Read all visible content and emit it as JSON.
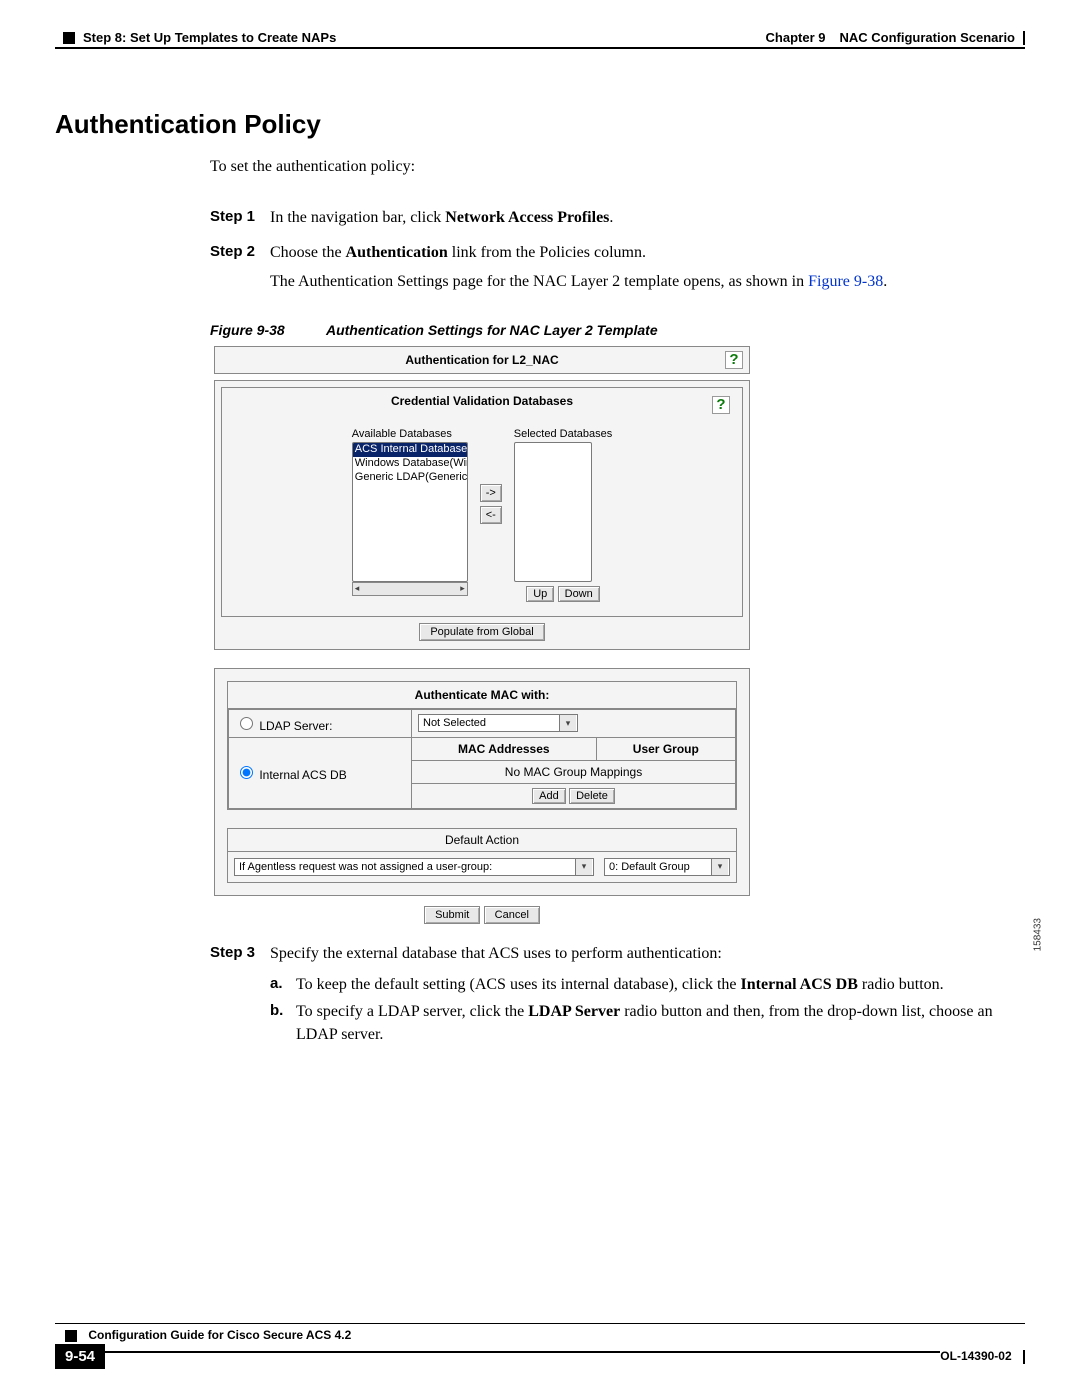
{
  "header": {
    "left": "Step 8: Set Up Templates to Create NAPs",
    "right_chapter": "Chapter 9",
    "right_title": "NAC Configuration Scenario"
  },
  "section_title": "Authentication Policy",
  "intro": "To set the authentication policy:",
  "steps": {
    "s1_label": "Step 1",
    "s1_pre": "In the navigation bar, click ",
    "s1_bold": "Network Access Profiles",
    "s1_post": ".",
    "s2_label": "Step 2",
    "s2_line1_pre": "Choose the ",
    "s2_line1_bold": "Authentication",
    "s2_line1_post": " link from the Policies column.",
    "s2_line2_pre": "The Authentication Settings page for the NAC Layer 2 template opens, as shown in ",
    "s2_line2_link": "Figure 9-38",
    "s2_line2_post": "."
  },
  "figure": {
    "label": "Figure 9-38",
    "caption": "Authentication Settings for NAC Layer 2 Template",
    "image_id": "158433"
  },
  "dialog": {
    "title": "Authentication for L2_NAC",
    "cred_title": "Credential Validation Databases",
    "available_label": "Available Databases",
    "selected_label": "Selected Databases",
    "available_options": [
      "ACS Internal Database",
      "Windows Database(Windo",
      "Generic LDAP(Generic LI"
    ],
    "arrow_right": "->",
    "arrow_left": "<-",
    "up": "Up",
    "down": "Down",
    "populate": "Populate from Global",
    "auth_mac_title": "Authenticate MAC with:",
    "ldap_label": "LDAP Server:",
    "ldap_selected": "Not Selected",
    "table_hdr_mac": "MAC Addresses",
    "table_hdr_group": "User Group",
    "no_mappings": "No MAC Group Mappings",
    "add": "Add",
    "delete": "Delete",
    "internal_label": "Internal ACS DB",
    "default_action": "Default Action",
    "agentless_text": "If Agentless request was not assigned a user-group:",
    "default_group": "0: Default Group",
    "submit": "Submit",
    "cancel": "Cancel"
  },
  "step3": {
    "label": "Step 3",
    "text": "Specify the external database that ACS uses to perform authentication:",
    "a_label": "a.",
    "a_pre": "To keep the default setting (ACS uses its internal database), click the ",
    "a_bold": "Internal ACS DB",
    "a_post": " radio button.",
    "b_label": "b.",
    "b_pre": "To specify a LDAP server, click the ",
    "b_bold": "LDAP Server",
    "b_post": " radio button and then, from the drop-down list, choose an LDAP server."
  },
  "footer": {
    "title": "Configuration Guide for Cisco Secure ACS 4.2",
    "page": "9-54",
    "docnum": "OL-14390-02"
  }
}
